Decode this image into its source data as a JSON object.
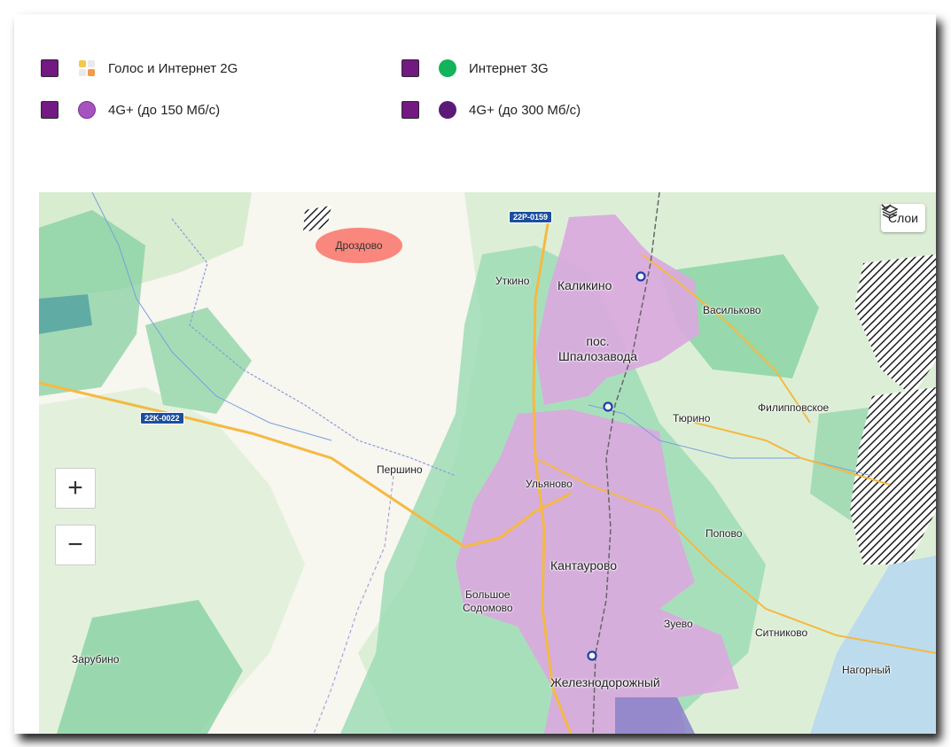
{
  "legend": {
    "items": [
      {
        "label": "Голос и Интернет 2G",
        "icon": "2g-coverage-icon"
      },
      {
        "label": "Интернет 3G",
        "icon": "3g-coverage-icon",
        "color": "#13b35c"
      },
      {
        "label": "4G+ (до 150 Мб/с)",
        "icon": "4g-150-coverage-icon",
        "color": "#a653c0"
      },
      {
        "label": "4G+ (до 300 Мб/с)",
        "icon": "4g-300-coverage-icon",
        "color": "#5b1a78"
      }
    ],
    "checkbox_color": "#731982"
  },
  "map": {
    "layers_label": "Слои",
    "zoom_in": "+",
    "zoom_out": "−",
    "highlighted_place": "Дроздово",
    "roads": [
      "22P-0159",
      "22K-0022"
    ],
    "places": {
      "utkino": "Уткино",
      "kalikino": "Каликино",
      "vasilkovo": "Васильково",
      "shpalozavoda": "пос.\nШпалозавода",
      "turino": "Тюрино",
      "filippovskoe": "Филипповское",
      "pershino": "Першино",
      "ulyanovo": "Ульяново",
      "popovo": "Попово",
      "kantaurovo": "Кантаурово",
      "bolshoe_sodomovo": "Большое\nСодомово",
      "zuevo": "Зуево",
      "sitnikovo": "Ситниково",
      "zarubino": "Зарубино",
      "nagorny": "Нагорный",
      "zheleznodorozhny": "Железнодорожный"
    },
    "colors": {
      "coverage_3g": "#9fdcb6",
      "coverage_4g": "#d9a9de",
      "forest": "#7fcf9c"
    }
  }
}
